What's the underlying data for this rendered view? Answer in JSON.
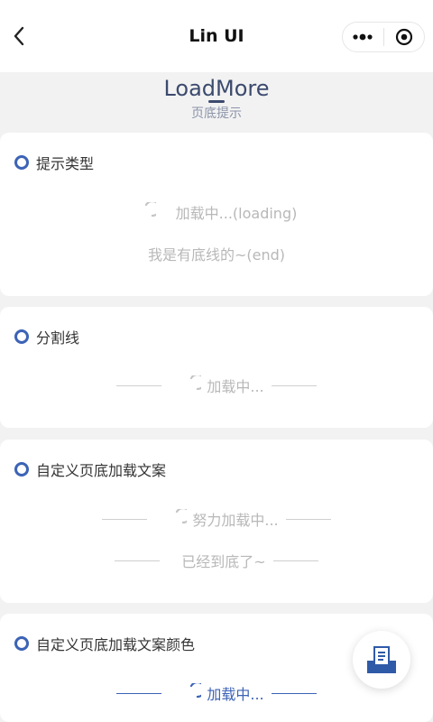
{
  "navbar": {
    "title": "Lin UI",
    "back_icon": "chevron-left-icon",
    "more_icon": "more-dots-icon",
    "close_icon": "target-icon"
  },
  "header": {
    "title": "LoadMore",
    "subtitle": "页底提示"
  },
  "sections": [
    {
      "title": "提示类型",
      "loading_text": "加载中...(loading)",
      "end_text": "我是有底线的~(end)"
    },
    {
      "title": "分割线",
      "loading_text": "加载中..."
    },
    {
      "title": "自定义页底加载文案",
      "loading_text": "努力加载中...",
      "end_text": "已经到底了~"
    },
    {
      "title": "自定义页底加载文案颜色",
      "loading_text": "加载中..."
    }
  ],
  "fab_icon": "document-tray-icon",
  "colors": {
    "accent": "#3c63b6",
    "title": "#3c4a6e",
    "muted": "#b8b8b8",
    "background": "#f2f2f2"
  }
}
